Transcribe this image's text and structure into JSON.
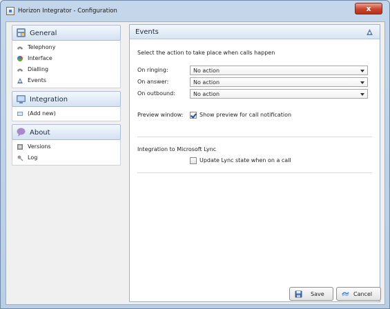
{
  "window": {
    "title": "Horizon Integrator - Configuration",
    "close_label": "x"
  },
  "nav": {
    "sections": [
      {
        "label": "General",
        "icon": "general-icon",
        "items": [
          {
            "label": "Telephony",
            "icon": "telephony-icon"
          },
          {
            "label": "Interface",
            "icon": "interface-icon"
          },
          {
            "label": "Dialling",
            "icon": "dialling-icon"
          },
          {
            "label": "Events",
            "icon": "events-icon"
          }
        ]
      },
      {
        "label": "Integration",
        "icon": "integration-icon",
        "items": [
          {
            "label": "(Add new)",
            "icon": "add-new-icon"
          }
        ]
      },
      {
        "label": "About",
        "icon": "about-icon",
        "items": [
          {
            "label": "Versions",
            "icon": "versions-icon"
          },
          {
            "label": "Log",
            "icon": "log-icon"
          }
        ]
      }
    ]
  },
  "content": {
    "title": "Events",
    "intro": "Select the action to take place when calls happen",
    "rows": [
      {
        "label": "On ringing:",
        "value": "No action"
      },
      {
        "label": "On answer:",
        "value": "No action"
      },
      {
        "label": "On outbound:",
        "value": "No action"
      }
    ],
    "preview": {
      "label": "Preview window:",
      "checkbox_label": "Show preview for call notification",
      "checked": true
    },
    "lync": {
      "heading": "Integration to Microsoft Lync",
      "checkbox_label": "Update Lync state when on a call",
      "checked": false
    }
  },
  "footer": {
    "save_label": "Save",
    "cancel_label": "Cancel"
  },
  "colors": {
    "accent": "#3d7fd0",
    "close": "#c9432c",
    "panel_header": "#d3e1f1"
  }
}
